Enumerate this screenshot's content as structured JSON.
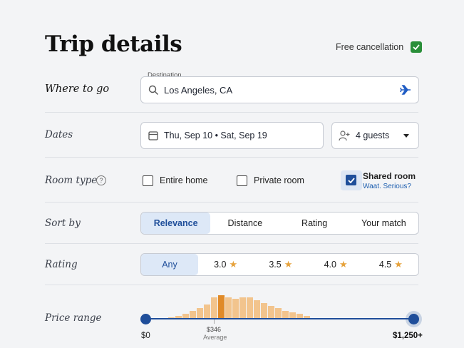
{
  "title": "Trip details",
  "free_cancellation": {
    "label": "Free cancellation",
    "checked": true
  },
  "rows": {
    "where": "Where to go",
    "dates": "Dates",
    "room_type": "Room type",
    "sort_by": "Sort by",
    "rating": "Rating",
    "price_range": "Price range"
  },
  "destination": {
    "caption": "Destination",
    "value": "Los Angeles, CA"
  },
  "dates": {
    "value": "Thu, Sep 10 • Sat, Sep 19"
  },
  "guests": {
    "value": "4 guests"
  },
  "room_types": {
    "help": "?",
    "entire_home": {
      "label": "Entire home",
      "checked": false
    },
    "private_room": {
      "label": "Private room",
      "checked": false
    },
    "shared_room": {
      "label": "Shared room",
      "sub": "Waat. Serious?",
      "checked": true
    }
  },
  "sort_options": [
    "Relevance",
    "Distance",
    "Rating",
    "Your match"
  ],
  "sort_selected": "Relevance",
  "rating_options": [
    "Any",
    "3.0",
    "3.5",
    "4.0",
    "4.5"
  ],
  "rating_selected": "Any",
  "price": {
    "min": "$0",
    "max": "$1,250+",
    "average_value": "$346",
    "average_label": "Average",
    "histogram": [
      0.05,
      0.1,
      0.2,
      0.3,
      0.4,
      0.55,
      0.8,
      0.9,
      0.8,
      0.75,
      0.8,
      0.8,
      0.7,
      0.6,
      0.5,
      0.4,
      0.3,
      0.25,
      0.2,
      0.1
    ],
    "histogram_highlight_index": 7
  },
  "colors": {
    "accent": "#1f4e9a",
    "check_green": "#2a8f3a",
    "histogram": "#f2c48d",
    "histogram_highlight": "#e08a28",
    "star": "#e6a23c"
  }
}
